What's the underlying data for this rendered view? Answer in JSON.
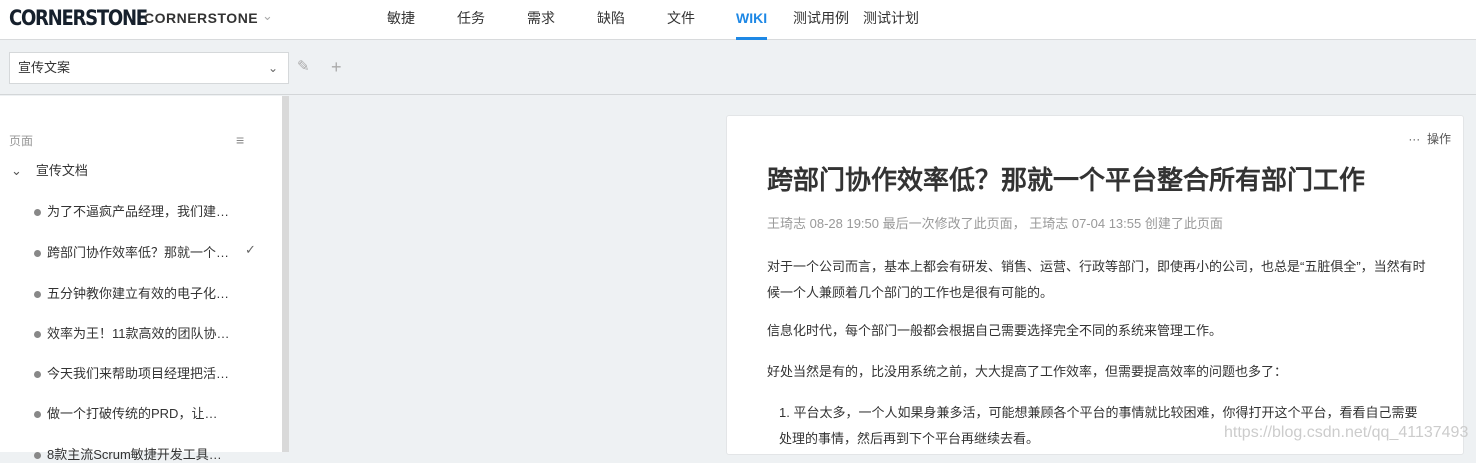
{
  "header": {
    "logo": "CORNERSTONE",
    "project": "CORNERSTONE",
    "nav": [
      "敏捷",
      "任务",
      "需求",
      "缺陷",
      "文件",
      "WIKI",
      "测试用例",
      "测试计划"
    ],
    "active": "WIKI"
  },
  "toolbar": {
    "space_select": "宣传文案"
  },
  "sidebar": {
    "heading": "页面",
    "folder": "宣传文档",
    "items": [
      "为了不逼疯产品经理，我们建…",
      "跨部门协作效率低？那就一个…",
      "五分钟教你建立有效的电子化…",
      "效率为王！11款高效的团队协…",
      "今天我们来帮助项目经理把活…",
      "做一个打破传统的PRD，让…",
      "8款主流Scrum敏捷开发工具…"
    ],
    "selected_index": 1
  },
  "page": {
    "ops": "操作",
    "title": "跨部门协作效率低？那就一个平台整合所有部门工作",
    "meta": "王琦志 08-28 19:50 最后一次修改了此页面， 王琦志 07-04 13:55 创建了此页面",
    "p1": "对于一个公司而言，基本上都会有研发、销售、运营、行政等部门，即使再小的公司，也总是“五脏俱全”，当然有时候一个人兼顾着几个部门的工作也是很有可能的。",
    "p2": "信息化时代，每个部门一般都会根据自己需要选择完全不同的系统来管理工作。",
    "p3": "好处当然是有的，比没用系统之前，大大提高了工作效率，但需要提高效率的问题也多了：",
    "li1": "1. 平台太多，一个人如果身兼多活，可能想兼顾各个平台的事情就比较困难，你得打开这个平台，看看自己需要处理的事情，然后再到下个平台再继续去看。"
  },
  "watermark": "https://blog.csdn.net/qq_41137493",
  "colors": {
    "accent": "#1e88e5"
  }
}
